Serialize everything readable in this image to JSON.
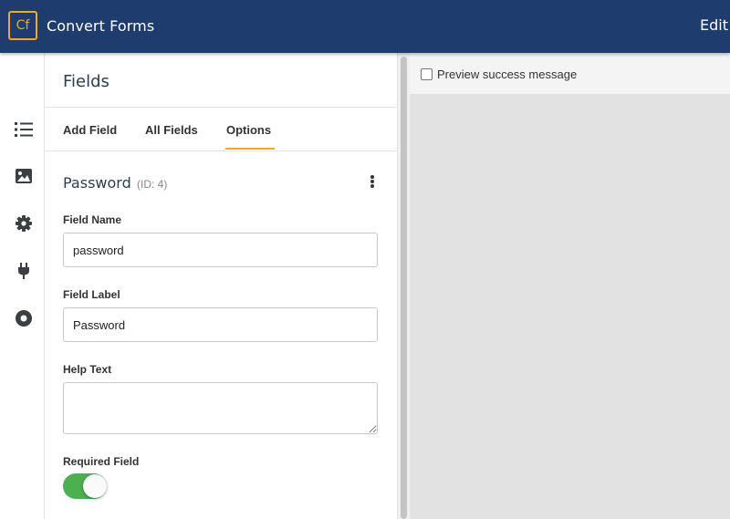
{
  "header": {
    "logo_text": "Cf",
    "app_name": "Convert Forms",
    "page_title": "Edit F"
  },
  "rail": {
    "icons": [
      "list-icon",
      "image-icon",
      "gear-icon",
      "plug-icon",
      "circle-dot-icon"
    ]
  },
  "panel": {
    "title": "Fields",
    "tabs": [
      {
        "label": "Add Field",
        "active": false
      },
      {
        "label": "All Fields",
        "active": false
      },
      {
        "label": "Options",
        "active": true
      }
    ],
    "field": {
      "name": "Password",
      "id_text": "(ID: 4)"
    },
    "field_name": {
      "label": "Field Name",
      "value": "password"
    },
    "field_label": {
      "label": "Field Label",
      "value": "Password"
    },
    "help_text": {
      "label": "Help Text",
      "value": ""
    },
    "required": {
      "label": "Required Field",
      "enabled": true
    }
  },
  "preview": {
    "checkbox_label": "Preview success message",
    "checked": false
  },
  "colors": {
    "header_bg": "#1e3c6e",
    "accent": "#f2a922",
    "toggle_on": "#4caf50"
  }
}
